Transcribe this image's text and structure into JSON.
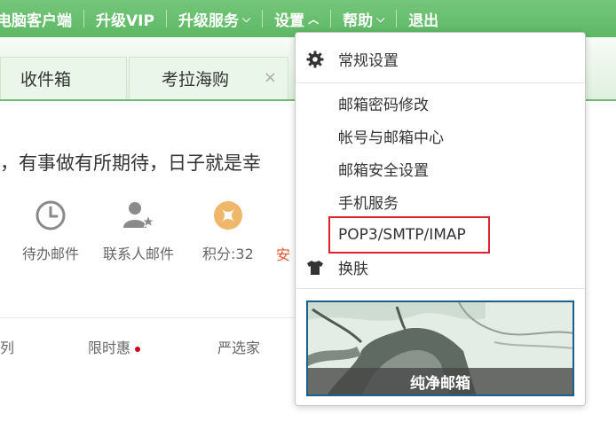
{
  "topnav": {
    "client": "电脑客户端",
    "upgrade_vip": "升级VIP",
    "upgrade_service": "升级服务",
    "settings": "设置",
    "help": "帮助",
    "logout": "退出"
  },
  "tabs": [
    {
      "label": "收件箱"
    },
    {
      "label": "考拉海购",
      "close": "×"
    }
  ],
  "main": {
    "slogan": "，有事做有所期待，日子就是幸",
    "quick_links": [
      {
        "label": "待办邮件",
        "icon": "clock-icon"
      },
      {
        "label": "联系人邮件",
        "icon": "contact-star-icon"
      },
      {
        "label": "积分:32",
        "icon": "points-icon"
      }
    ],
    "safe_fragment": "安",
    "bottom_links": [
      "列",
      "限时惠",
      "严选家"
    ]
  },
  "dropdown": {
    "general": "常规设置",
    "password": "邮箱密码修改",
    "account_center": "帐号与邮箱中心",
    "security": "邮箱安全设置",
    "mobile": "手机服务",
    "pop": "POP3/SMTP/IMAP",
    "skin": "换肤",
    "promo_caption": "纯净邮箱"
  },
  "colors": {
    "topbar": "#5eb865",
    "highlight_border": "#d9232d",
    "promo_border": "#1f5f8b"
  }
}
